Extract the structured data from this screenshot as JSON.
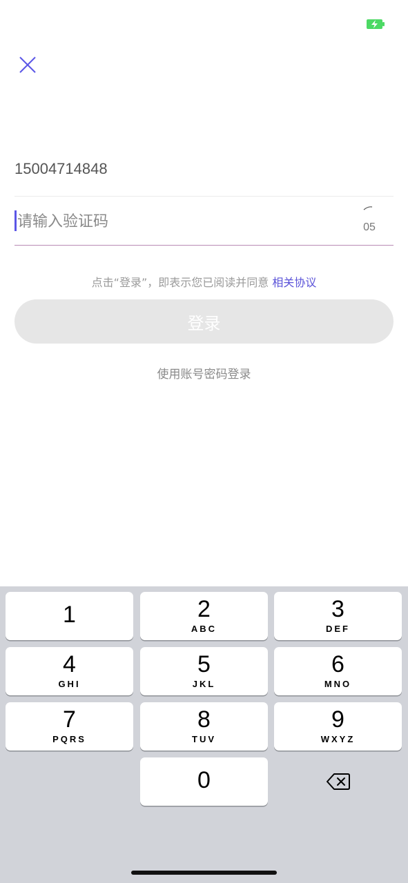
{
  "status_bar": {
    "battery_icon": "battery-charging-icon",
    "battery_color": "#4cd964"
  },
  "header": {
    "close_icon": "close-icon",
    "close_color": "#5b56e6"
  },
  "form": {
    "phone_value": "15004714848",
    "code_placeholder": "请输入验证码",
    "code_value": "",
    "countdown": "05"
  },
  "agreement": {
    "prefix": "点击“登录”，即表示您已阅读并同意 ",
    "link": "相关协议",
    "link_color": "#5a52d8"
  },
  "login_button": {
    "label": "登录",
    "background": "#e6e6e6"
  },
  "alt_login": {
    "label": "使用账号密码登录"
  },
  "keyboard": {
    "keys": [
      {
        "digit": "1",
        "letters": ""
      },
      {
        "digit": "2",
        "letters": "ABC"
      },
      {
        "digit": "3",
        "letters": "DEF"
      },
      {
        "digit": "4",
        "letters": "GHI"
      },
      {
        "digit": "5",
        "letters": "JKL"
      },
      {
        "digit": "6",
        "letters": "MNO"
      },
      {
        "digit": "7",
        "letters": "PQRS"
      },
      {
        "digit": "8",
        "letters": "TUV"
      },
      {
        "digit": "9",
        "letters": "WXYZ"
      },
      {
        "digit": "0",
        "letters": ""
      }
    ],
    "delete_icon": "backspace-icon",
    "background": "#d1d3d9"
  }
}
